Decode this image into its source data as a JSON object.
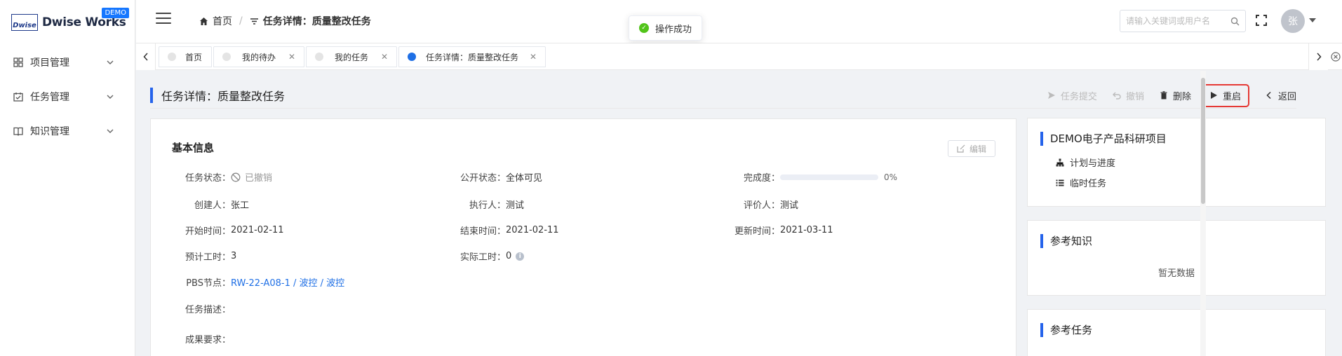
{
  "app": {
    "logo_mark": "Dwise",
    "name": "Dwise Works",
    "badge": "DEMO"
  },
  "sidebar": {
    "items": [
      {
        "label": "项目管理",
        "icon": "grid-icon"
      },
      {
        "label": "任务管理",
        "icon": "calendar-check-icon"
      },
      {
        "label": "知识管理",
        "icon": "book-icon"
      }
    ]
  },
  "header": {
    "breadcrumb": {
      "home": "首页",
      "current": "任务详情：质量整改任务"
    },
    "toast": "操作成功",
    "search_placeholder": "请输入关键词或用户名",
    "avatar": "张"
  },
  "tabs": [
    {
      "label": "首页",
      "closable": false,
      "active": false
    },
    {
      "label": "我的待办",
      "closable": true,
      "active": false
    },
    {
      "label": "我的任务",
      "closable": true,
      "active": false
    },
    {
      "label": "任务详情：质量整改任务",
      "closable": true,
      "active": true
    }
  ],
  "page": {
    "title": "任务详情：质量整改任务",
    "actions": {
      "submit": "任务提交",
      "revoke": "撤销",
      "delete": "删除",
      "restart": "重启",
      "back": "返回"
    }
  },
  "basic": {
    "title": "基本信息",
    "edit": "编辑",
    "status_label": "任务状态：",
    "status_value": "已撤销",
    "public_label": "公开状态：",
    "public_value": "全体可见",
    "completion_label": "完成度：",
    "completion_value": "0%",
    "completion_fraction": 0,
    "creator_label": "创建人：",
    "creator_value": "张工",
    "executor_label": "执行人：",
    "executor_value": "测试",
    "reviewer_label": "评价人：",
    "reviewer_value": "测试",
    "start_label": "开始时间：",
    "start_value": "2021-02-11",
    "end_label": "结束时间：",
    "end_value": "2021-02-11",
    "update_label": "更新时间：",
    "update_value": "2021-03-11",
    "planned_label": "预计工时：",
    "planned_value": "3",
    "actual_label": "实际工时：",
    "actual_value": "0",
    "pbs_label": "PBS节点：",
    "pbs_value": "RW-22-A08-1 / 波控 / 波控",
    "desc_label": "任务描述：",
    "req_label": "成果要求："
  },
  "project_card": {
    "title": "DEMO电子产品科研项目",
    "links": [
      {
        "label": "计划与进度",
        "icon": "sitemap-icon"
      },
      {
        "label": "临时任务",
        "icon": "list-icon"
      }
    ]
  },
  "knowledge_card": {
    "title": "参考知识",
    "empty": "暂无数据"
  },
  "tasks_card": {
    "title": "参考任务"
  },
  "colors": {
    "accent": "#2563eb",
    "highlight": "#e53935",
    "success": "#52c41a"
  }
}
